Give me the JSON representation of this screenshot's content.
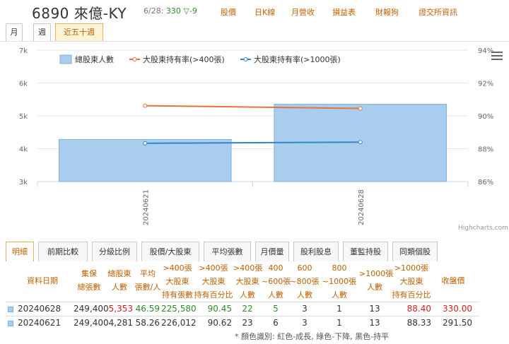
{
  "header": {
    "stock_title": "6890 來億-KY",
    "quote_date": "6/28:",
    "quote_price": "330",
    "quote_change": "▽-9",
    "nav_links": [
      "股價",
      "日K線",
      "月營收",
      "損益表",
      "財報狗",
      "證交所資訊"
    ]
  },
  "period_tabs": [
    "月",
    "週",
    "近五十週"
  ],
  "chart_data": {
    "type": "bar",
    "categories": [
      "20240621",
      "20240628"
    ],
    "legend": [
      "總股東人數",
      "大股東持有率(>400張)",
      "大股東持有率(>1000張)"
    ],
    "series": [
      {
        "name": "總股東人數",
        "type": "bar",
        "axis": "left",
        "values": [
          4281,
          5353
        ]
      },
      {
        "name": "大股東持有率(>400張)",
        "type": "line",
        "axis": "right",
        "values": [
          90.62,
          90.45
        ]
      },
      {
        "name": "大股東持有率(>1000張)",
        "type": "line",
        "axis": "right",
        "values": [
          88.33,
          88.4
        ]
      }
    ],
    "y_left": {
      "range": [
        3000,
        7000
      ],
      "ticks": [
        "3k",
        "4k",
        "5k",
        "6k",
        "7k"
      ]
    },
    "y_right": {
      "range": [
        86,
        94
      ],
      "ticks": [
        "86%",
        "88%",
        "90%",
        "92%",
        "94%"
      ]
    },
    "colors": {
      "bar": "#a9cdee",
      "bar_border": "#7fb0dc",
      "line400": "#e8733a",
      "line1000": "#2f86c9"
    },
    "credit": "Highcharts.com"
  },
  "bottom_tabs": [
    "明細",
    "前期比較",
    "分級比例",
    "股價/大股東",
    "平均張數",
    "月價量",
    "股利股息",
    "董監持股",
    "同類個股"
  ],
  "table": {
    "headers": [
      [
        "資料日期"
      ],
      [
        "集保",
        "總張數"
      ],
      [
        "總股東",
        "人數"
      ],
      [
        "平均",
        "張數/人"
      ],
      [
        ">400張",
        "大股東",
        "持有張數"
      ],
      [
        ">400張",
        "大股東",
        "持有百分比"
      ],
      [
        ">400張",
        "大股東",
        "人數"
      ],
      [
        "400",
        "~600張",
        "人數"
      ],
      [
        "600",
        "~800張",
        "人數"
      ],
      [
        "800",
        "~1000張",
        "人數"
      ],
      [
        ">1000張",
        "人數"
      ],
      [
        ">1000張",
        "大股東",
        "持有百分比"
      ],
      [
        "收盤價"
      ]
    ],
    "rows": [
      [
        "20240628",
        "249,400",
        "5,353",
        "46.59",
        "225,580",
        "90.45",
        "22",
        "5",
        "3",
        "1",
        "13",
        "88.40",
        "330.00"
      ],
      [
        "20240621",
        "249,400",
        "4,281",
        "58.26",
        "226,012",
        "90.62",
        "23",
        "6",
        "3",
        "1",
        "13",
        "88.33",
        "291.50"
      ]
    ],
    "note": "* 顏色識別: 紅色-成長, 綠色-下降, 黑色-持平"
  }
}
